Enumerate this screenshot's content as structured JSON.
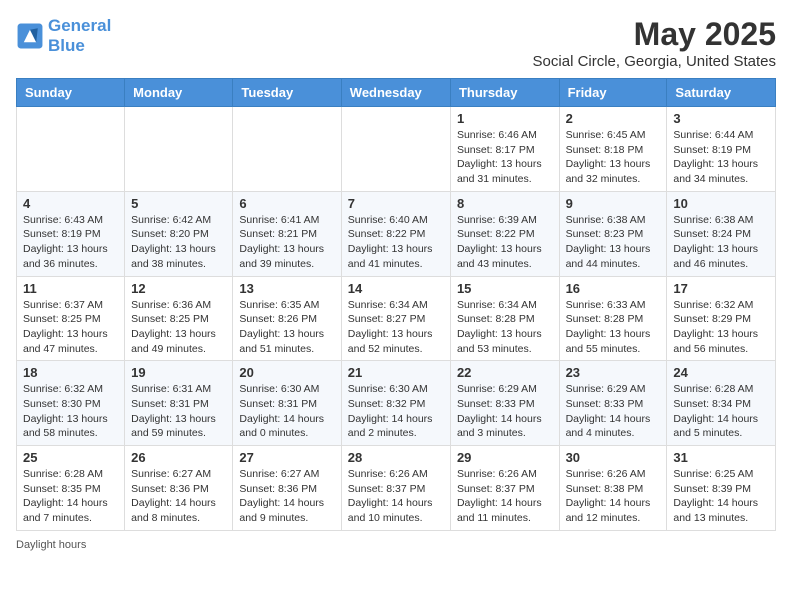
{
  "header": {
    "logo_line1": "General",
    "logo_line2": "Blue",
    "month_title": "May 2025",
    "subtitle": "Social Circle, Georgia, United States"
  },
  "days_of_week": [
    "Sunday",
    "Monday",
    "Tuesday",
    "Wednesday",
    "Thursday",
    "Friday",
    "Saturday"
  ],
  "weeks": [
    [
      {
        "day": "",
        "sunrise": "",
        "sunset": "",
        "daylight": ""
      },
      {
        "day": "",
        "sunrise": "",
        "sunset": "",
        "daylight": ""
      },
      {
        "day": "",
        "sunrise": "",
        "sunset": "",
        "daylight": ""
      },
      {
        "day": "",
        "sunrise": "",
        "sunset": "",
        "daylight": ""
      },
      {
        "day": "1",
        "sunrise": "Sunrise: 6:46 AM",
        "sunset": "Sunset: 8:17 PM",
        "daylight": "Daylight: 13 hours and 31 minutes."
      },
      {
        "day": "2",
        "sunrise": "Sunrise: 6:45 AM",
        "sunset": "Sunset: 8:18 PM",
        "daylight": "Daylight: 13 hours and 32 minutes."
      },
      {
        "day": "3",
        "sunrise": "Sunrise: 6:44 AM",
        "sunset": "Sunset: 8:19 PM",
        "daylight": "Daylight: 13 hours and 34 minutes."
      }
    ],
    [
      {
        "day": "4",
        "sunrise": "Sunrise: 6:43 AM",
        "sunset": "Sunset: 8:19 PM",
        "daylight": "Daylight: 13 hours and 36 minutes."
      },
      {
        "day": "5",
        "sunrise": "Sunrise: 6:42 AM",
        "sunset": "Sunset: 8:20 PM",
        "daylight": "Daylight: 13 hours and 38 minutes."
      },
      {
        "day": "6",
        "sunrise": "Sunrise: 6:41 AM",
        "sunset": "Sunset: 8:21 PM",
        "daylight": "Daylight: 13 hours and 39 minutes."
      },
      {
        "day": "7",
        "sunrise": "Sunrise: 6:40 AM",
        "sunset": "Sunset: 8:22 PM",
        "daylight": "Daylight: 13 hours and 41 minutes."
      },
      {
        "day": "8",
        "sunrise": "Sunrise: 6:39 AM",
        "sunset": "Sunset: 8:22 PM",
        "daylight": "Daylight: 13 hours and 43 minutes."
      },
      {
        "day": "9",
        "sunrise": "Sunrise: 6:38 AM",
        "sunset": "Sunset: 8:23 PM",
        "daylight": "Daylight: 13 hours and 44 minutes."
      },
      {
        "day": "10",
        "sunrise": "Sunrise: 6:38 AM",
        "sunset": "Sunset: 8:24 PM",
        "daylight": "Daylight: 13 hours and 46 minutes."
      }
    ],
    [
      {
        "day": "11",
        "sunrise": "Sunrise: 6:37 AM",
        "sunset": "Sunset: 8:25 PM",
        "daylight": "Daylight: 13 hours and 47 minutes."
      },
      {
        "day": "12",
        "sunrise": "Sunrise: 6:36 AM",
        "sunset": "Sunset: 8:25 PM",
        "daylight": "Daylight: 13 hours and 49 minutes."
      },
      {
        "day": "13",
        "sunrise": "Sunrise: 6:35 AM",
        "sunset": "Sunset: 8:26 PM",
        "daylight": "Daylight: 13 hours and 51 minutes."
      },
      {
        "day": "14",
        "sunrise": "Sunrise: 6:34 AM",
        "sunset": "Sunset: 8:27 PM",
        "daylight": "Daylight: 13 hours and 52 minutes."
      },
      {
        "day": "15",
        "sunrise": "Sunrise: 6:34 AM",
        "sunset": "Sunset: 8:28 PM",
        "daylight": "Daylight: 13 hours and 53 minutes."
      },
      {
        "day": "16",
        "sunrise": "Sunrise: 6:33 AM",
        "sunset": "Sunset: 8:28 PM",
        "daylight": "Daylight: 13 hours and 55 minutes."
      },
      {
        "day": "17",
        "sunrise": "Sunrise: 6:32 AM",
        "sunset": "Sunset: 8:29 PM",
        "daylight": "Daylight: 13 hours and 56 minutes."
      }
    ],
    [
      {
        "day": "18",
        "sunrise": "Sunrise: 6:32 AM",
        "sunset": "Sunset: 8:30 PM",
        "daylight": "Daylight: 13 hours and 58 minutes."
      },
      {
        "day": "19",
        "sunrise": "Sunrise: 6:31 AM",
        "sunset": "Sunset: 8:31 PM",
        "daylight": "Daylight: 13 hours and 59 minutes."
      },
      {
        "day": "20",
        "sunrise": "Sunrise: 6:30 AM",
        "sunset": "Sunset: 8:31 PM",
        "daylight": "Daylight: 14 hours and 0 minutes."
      },
      {
        "day": "21",
        "sunrise": "Sunrise: 6:30 AM",
        "sunset": "Sunset: 8:32 PM",
        "daylight": "Daylight: 14 hours and 2 minutes."
      },
      {
        "day": "22",
        "sunrise": "Sunrise: 6:29 AM",
        "sunset": "Sunset: 8:33 PM",
        "daylight": "Daylight: 14 hours and 3 minutes."
      },
      {
        "day": "23",
        "sunrise": "Sunrise: 6:29 AM",
        "sunset": "Sunset: 8:33 PM",
        "daylight": "Daylight: 14 hours and 4 minutes."
      },
      {
        "day": "24",
        "sunrise": "Sunrise: 6:28 AM",
        "sunset": "Sunset: 8:34 PM",
        "daylight": "Daylight: 14 hours and 5 minutes."
      }
    ],
    [
      {
        "day": "25",
        "sunrise": "Sunrise: 6:28 AM",
        "sunset": "Sunset: 8:35 PM",
        "daylight": "Daylight: 14 hours and 7 minutes."
      },
      {
        "day": "26",
        "sunrise": "Sunrise: 6:27 AM",
        "sunset": "Sunset: 8:36 PM",
        "daylight": "Daylight: 14 hours and 8 minutes."
      },
      {
        "day": "27",
        "sunrise": "Sunrise: 6:27 AM",
        "sunset": "Sunset: 8:36 PM",
        "daylight": "Daylight: 14 hours and 9 minutes."
      },
      {
        "day": "28",
        "sunrise": "Sunrise: 6:26 AM",
        "sunset": "Sunset: 8:37 PM",
        "daylight": "Daylight: 14 hours and 10 minutes."
      },
      {
        "day": "29",
        "sunrise": "Sunrise: 6:26 AM",
        "sunset": "Sunset: 8:37 PM",
        "daylight": "Daylight: 14 hours and 11 minutes."
      },
      {
        "day": "30",
        "sunrise": "Sunrise: 6:26 AM",
        "sunset": "Sunset: 8:38 PM",
        "daylight": "Daylight: 14 hours and 12 minutes."
      },
      {
        "day": "31",
        "sunrise": "Sunrise: 6:25 AM",
        "sunset": "Sunset: 8:39 PM",
        "daylight": "Daylight: 14 hours and 13 minutes."
      }
    ]
  ],
  "footer": {
    "daylight_label": "Daylight hours"
  }
}
